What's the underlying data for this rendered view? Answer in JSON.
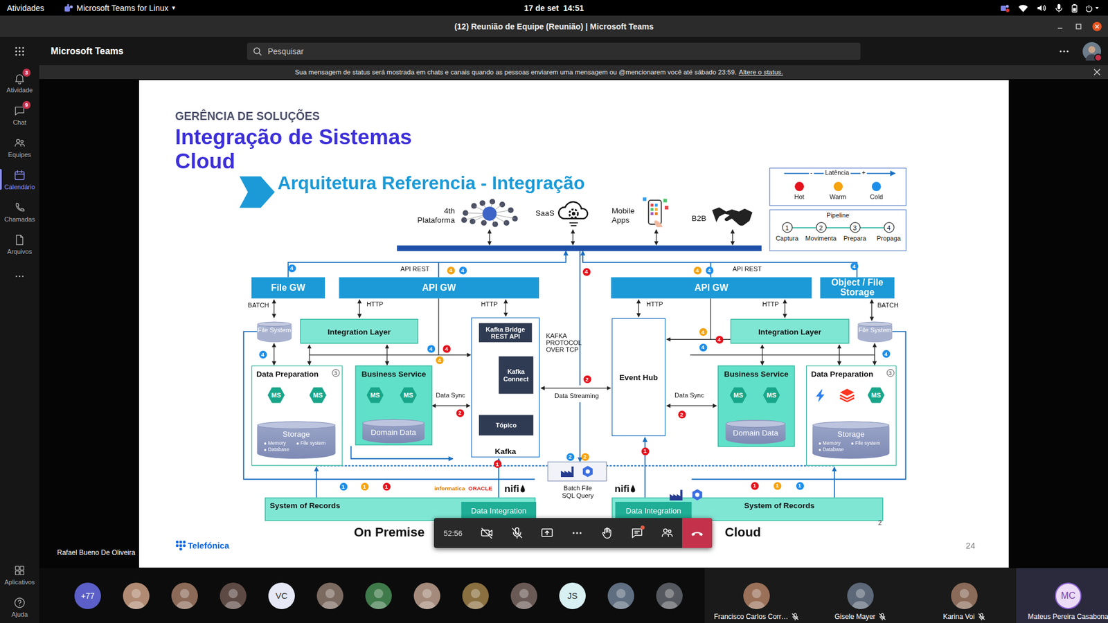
{
  "topbar": {
    "activities": "Atividades",
    "app": "Microsoft Teams for Linux",
    "caret": "▾",
    "clock": "17 de set  14:51"
  },
  "window": {
    "title": "(12) Reunião de Equipe (Reunião) | Microsoft Teams"
  },
  "header": {
    "app_name": "Microsoft Teams",
    "search": {
      "placeholder": "Pesquisar"
    },
    "busy": true
  },
  "rail": {
    "items": [
      {
        "label": "Atividade",
        "badge": "3",
        "selected": false
      },
      {
        "label": "Chat",
        "badge": "9",
        "selected": false
      },
      {
        "label": "Equipes",
        "badge": null,
        "selected": false
      },
      {
        "label": "Calendário",
        "badge": null,
        "selected": true
      },
      {
        "label": "Chamadas",
        "badge": null,
        "selected": false
      },
      {
        "label": "Arquivos",
        "badge": null,
        "selected": false
      }
    ],
    "bottom": [
      {
        "label": "Aplicativos"
      },
      {
        "label": "Ajuda"
      }
    ]
  },
  "banner": {
    "text": "Sua mensagem de status será mostrada em chats e canais quando as pessoas enviarem uma mensagem ou @mencionarem você até sábado 23:59.",
    "link": "Altere o status."
  },
  "slide": {
    "kicker": "GERÊNCIA DE SOLUÇÕES",
    "title": [
      "Integração de Sistemas",
      "Cloud"
    ],
    "subtitle": "Arquitetura Referencia - Integração",
    "channels": [
      {
        "label": "4th Plataforma"
      },
      {
        "label": "SaaS"
      },
      {
        "label": "Mobile Apps"
      },
      {
        "label": "B2B"
      }
    ],
    "latency": {
      "label": "Latência",
      "minus": "-",
      "plus": "+",
      "levels": [
        {
          "label": "Hot",
          "color": "#e5121c"
        },
        {
          "label": "Warm",
          "color": "#f5a30f"
        },
        {
          "label": "Cold",
          "color": "#1d8fea"
        }
      ]
    },
    "pipeline": {
      "label": "Pipeline",
      "steps": [
        {
          "number": "1",
          "label": "Captura"
        },
        {
          "number": "2",
          "label": "Movimenta"
        },
        {
          "number": "3",
          "label": "Prepara"
        },
        {
          "number": "4",
          "label": "Propaga"
        }
      ]
    },
    "nodes": [
      {
        "kind": "gateway",
        "label": "File GW"
      },
      {
        "kind": "gateway",
        "label": "API GW"
      },
      {
        "kind": "gateway",
        "label": "API GW"
      },
      {
        "kind": "gateway",
        "label": "Object / File Storage"
      },
      {
        "kind": "layer",
        "label": "Integration Layer"
      },
      {
        "kind": "layer",
        "label": "Integration Layer"
      },
      {
        "kind": "disk",
        "label": "File System"
      },
      {
        "kind": "disk",
        "label": "File System"
      },
      {
        "kind": "prep",
        "label": "Data Preparation"
      },
      {
        "kind": "service",
        "label": "Business Service"
      },
      {
        "kind": "service",
        "label": "Business Service"
      },
      {
        "kind": "prep",
        "label": "Data Preparation"
      },
      {
        "kind": "kafka",
        "label": "Kafka"
      },
      {
        "kind": "dark",
        "label": "Kafka Bridge REST API"
      },
      {
        "kind": "dark",
        "label": "Kafka Connect"
      },
      {
        "kind": "dark",
        "label": "Tópico"
      },
      {
        "kind": "hub",
        "label": "Event Hub"
      },
      {
        "kind": "storage",
        "label": "Storage",
        "bullets": [
          "Memory",
          "File system",
          "Database"
        ]
      },
      {
        "kind": "storage",
        "label": "Storage",
        "bullets": [
          "Memory",
          "File system",
          "Database"
        ]
      },
      {
        "kind": "domain",
        "label": "Domain Data"
      },
      {
        "kind": "domain",
        "label": "Domain Data"
      },
      {
        "kind": "ms",
        "label": "MS"
      },
      {
        "kind": "ms",
        "label": "MS"
      },
      {
        "kind": "ms",
        "label": "MS"
      },
      {
        "kind": "ms",
        "label": "MS"
      },
      {
        "kind": "ms",
        "label": "MS"
      },
      {
        "kind": "ms",
        "label": "MS"
      },
      {
        "kind": "ms",
        "label": "MS"
      },
      {
        "kind": "records",
        "label": "System of Records"
      },
      {
        "kind": "records",
        "label": "System of Records"
      },
      {
        "kind": "tab",
        "label": "Data Integration"
      },
      {
        "kind": "tab",
        "label": "Data Integration"
      }
    ],
    "labels": [
      "BATCH",
      "HTTP",
      "API REST",
      "HTTP",
      "KAFKA PROTOCOL OVER TCP",
      "Data Streaming",
      "Data Sync",
      "Data Sync",
      "HTTP",
      "API REST",
      "HTTP",
      "BATCH",
      "Batch File SQL Query"
    ],
    "badges": [
      {
        "number": "4",
        "kind": "latency",
        "color": "#1d8fea"
      },
      {
        "number": "4",
        "kind": "latency",
        "color": "#f5a30f"
      },
      {
        "number": "4",
        "kind": "latency",
        "color": "#1d8fea"
      },
      {
        "number": "4",
        "kind": "latency",
        "color": "#e5121c"
      },
      {
        "number": "4",
        "kind": "latency",
        "color": "#f5a30f"
      },
      {
        "number": "4",
        "kind": "latency",
        "color": "#1d8fea"
      },
      {
        "number": "4",
        "kind": "latency",
        "color": "#1d8fea"
      },
      {
        "number": "4",
        "kind": "latency",
        "color": "#1d8fea"
      },
      {
        "number": "4",
        "kind": "latency",
        "color": "#1d8fea"
      },
      {
        "number": "4",
        "kind": "latency",
        "color": "#e5121c"
      },
      {
        "number": "4",
        "kind": "latency",
        "color": "#f5a30f"
      },
      {
        "number": "4",
        "kind": "latency",
        "color": "#f5a30f"
      },
      {
        "number": "4",
        "kind": "latency",
        "color": "#1d8fea"
      },
      {
        "number": "4",
        "kind": "latency",
        "color": "#e5121c"
      },
      {
        "number": "4",
        "kind": "latency",
        "color": "#1d8fea"
      },
      {
        "number": "2",
        "kind": "latency",
        "color": "#e5121c"
      },
      {
        "number": "2",
        "kind": "latency",
        "color": "#e5121c"
      },
      {
        "number": "2",
        "kind": "latency",
        "color": "#e5121c"
      },
      {
        "number": "1",
        "kind": "latency",
        "color": "#e5121c"
      },
      {
        "number": "1",
        "kind": "latency",
        "color": "#e5121c"
      },
      {
        "number": "2",
        "kind": "latency",
        "color": "#1d8fea"
      },
      {
        "number": "2",
        "kind": "latency",
        "color": "#f5a30f"
      },
      {
        "number": "1",
        "kind": "latency",
        "color": "#1d8fea"
      },
      {
        "number": "1",
        "kind": "latency",
        "color": "#f5a30f"
      },
      {
        "number": "1",
        "kind": "latency",
        "color": "#e5121c"
      },
      {
        "number": "1",
        "kind": "latency",
        "color": "#e5121c"
      },
      {
        "number": "1",
        "kind": "latency",
        "color": "#f5a30f"
      },
      {
        "number": "1",
        "kind": "latency",
        "color": "#1d8fea"
      },
      {
        "number": "3",
        "kind": "step",
        "color": "#ffffff"
      },
      {
        "number": "3",
        "kind": "step",
        "color": "#ffffff"
      }
    ],
    "logos": [
      {
        "kind": "informatica",
        "text": "informatica"
      },
      {
        "kind": "oracle",
        "text": "ORACLE"
      },
      {
        "kind": "nifi",
        "text": "nifi"
      },
      {
        "kind": "nifi",
        "text": "nifi"
      }
    ],
    "regions": [
      {
        "label": "On Premise"
      },
      {
        "label": "Cloud"
      }
    ],
    "section": "2",
    "page": "24",
    "brand": "Telefónica"
  },
  "meeting": {
    "presenter": "Rafael Bueno De Oliveira",
    "timer": "52:56",
    "camera_on": false,
    "mic_on": false,
    "chat_unread": true
  },
  "participants": {
    "overflow": "+77",
    "avatars": [
      {
        "kind": "photo",
        "color": "#b08a72"
      },
      {
        "kind": "photo",
        "color": "#8c6a58"
      },
      {
        "kind": "photo",
        "color": "#5e4a44"
      },
      {
        "kind": "initials",
        "initials": "VC",
        "color": "#e6e8f6"
      },
      {
        "kind": "photo",
        "color": "#7b6a60"
      },
      {
        "kind": "photo",
        "color": "#3f7a4a"
      },
      {
        "kind": "photo",
        "color": "#a48a7a"
      },
      {
        "kind": "photo",
        "color": "#8a7040"
      },
      {
        "kind": "photo",
        "color": "#6a5a55"
      },
      {
        "kind": "initials",
        "initials": "JS",
        "color": "#d8f0f2"
      },
      {
        "kind": "photo",
        "color": "#5f6e80"
      },
      {
        "kind": "photo",
        "color": "#55585e"
      }
    ],
    "tiles": [
      {
        "name": "Francisco Carlos Corr…",
        "kind": "photo",
        "color": "#9a7058",
        "muted": true,
        "self": false
      },
      {
        "name": "Gisele Mayer",
        "kind": "photo",
        "color": "#5c6878",
        "muted": true,
        "self": false
      },
      {
        "name": "Karina Voi",
        "kind": "photo",
        "color": "#8a6a58",
        "muted": true,
        "self": false
      },
      {
        "name": "Mateus Pereira Casabona",
        "kind": "initials",
        "initials": "MC",
        "color": "#ecdcf6",
        "muted": false,
        "self": true
      }
    ]
  }
}
